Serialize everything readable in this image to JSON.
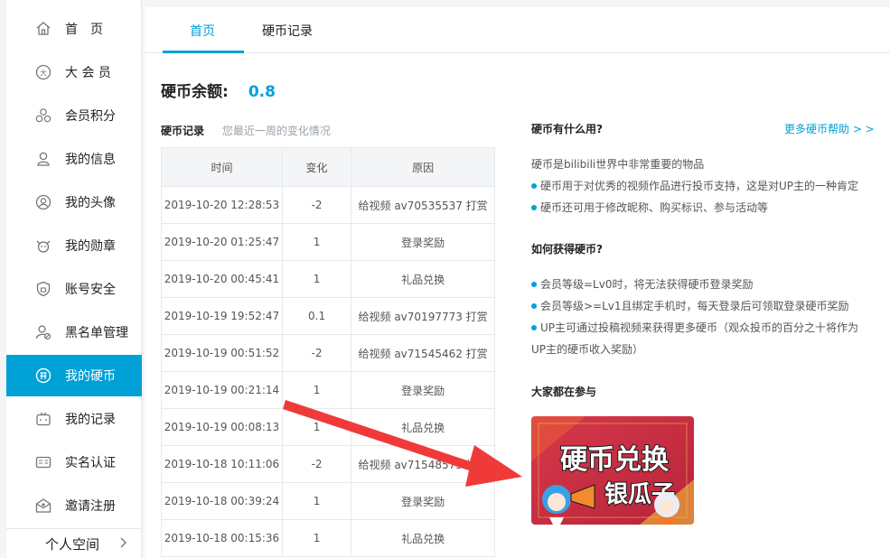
{
  "sidebar": {
    "items": [
      {
        "label": "首　页",
        "icon": "home-icon"
      },
      {
        "label": "大 会 员",
        "icon": "vip-icon"
      },
      {
        "label": "会员积分",
        "icon": "points-icon"
      },
      {
        "label": "我的信息",
        "icon": "user-icon"
      },
      {
        "label": "我的头像",
        "icon": "avatar-icon"
      },
      {
        "label": "我的勋章",
        "icon": "medal-icon"
      },
      {
        "label": "账号安全",
        "icon": "shield-icon"
      },
      {
        "label": "黑名单管理",
        "icon": "blacklist-icon"
      },
      {
        "label": "我的硬币",
        "icon": "coin-icon",
        "active": true
      },
      {
        "label": "我的记录",
        "icon": "tv-icon"
      },
      {
        "label": "实名认证",
        "icon": "id-card-icon"
      },
      {
        "label": "邀请注册",
        "icon": "invite-icon"
      }
    ],
    "footer_label": "个人空间"
  },
  "tabs": [
    {
      "label": "首页",
      "active": true
    },
    {
      "label": "硬币记录",
      "active": false
    }
  ],
  "balance": {
    "label": "硬币余额:",
    "value": "0.8"
  },
  "records": {
    "title": "硬币记录",
    "subtitle": "您最近一周的变化情况",
    "columns": [
      "时间",
      "变化",
      "原因"
    ],
    "rows": [
      [
        "2019-10-20 12:28:53",
        "-2",
        "给视频 av70535537 打赏"
      ],
      [
        "2019-10-20 01:25:47",
        "1",
        "登录奖励"
      ],
      [
        "2019-10-20 00:45:41",
        "1",
        "礼品兑换"
      ],
      [
        "2019-10-19 19:52:47",
        "0.1",
        "给视频 av70197773 打赏"
      ],
      [
        "2019-10-19 00:51:52",
        "-2",
        "给视频 av71545462 打赏"
      ],
      [
        "2019-10-19 00:21:14",
        "1",
        "登录奖励"
      ],
      [
        "2019-10-19 00:08:13",
        "1",
        "礼品兑换"
      ],
      [
        "2019-10-18 10:11:06",
        "-2",
        "给视频 av71548575 打赏"
      ],
      [
        "2019-10-18 00:39:24",
        "1",
        "登录奖励"
      ],
      [
        "2019-10-18 00:15:36",
        "1",
        "礼品兑换"
      ]
    ]
  },
  "info": {
    "what_title": "硬币有什么用?",
    "more_link": "更多硬币帮助 > >",
    "what_intro": "硬币是bilibili世界中非常重要的物品",
    "what_points": [
      "硬币用于对优秀的视频作品进行投币支持，这是对UP主的一种肯定",
      "硬币还可用于修改昵称、购买标识、参与活动等"
    ],
    "how_title": "如何获得硬币?",
    "how_points": [
      "会员等级=Lv0时，将无法获得硬币登录奖励",
      "会员等级>=Lv1且绑定手机时，每天登录后可领取登录硬币奖励",
      "UP主可通过投稿视频来获得更多硬币（观众投币的百分之十将作为"
    ],
    "how_points_cont": "UP主的硬币收入奖励）",
    "join_title": "大家都在参与"
  },
  "promo": {
    "text_line1": "硬币兑换",
    "text_line2": "银瓜子"
  },
  "colors": {
    "accent": "#00a1d6",
    "arrow": "#f03a3a"
  }
}
